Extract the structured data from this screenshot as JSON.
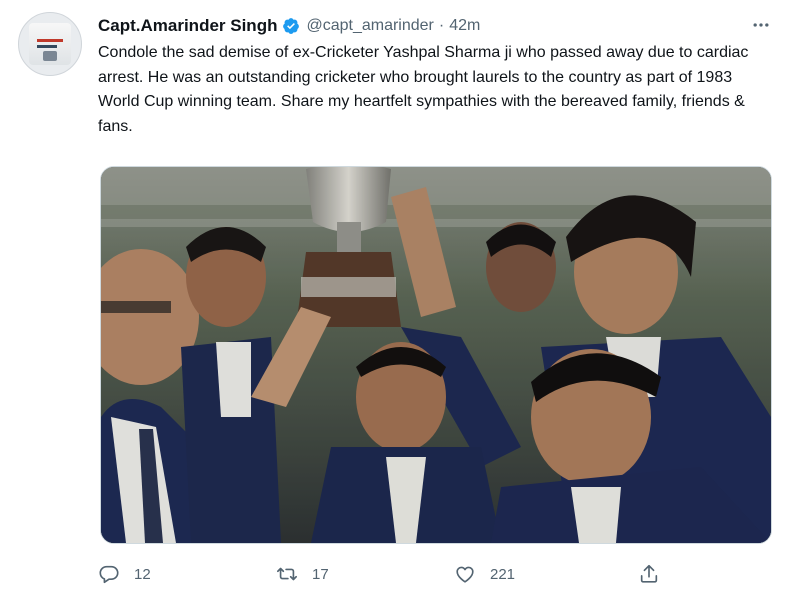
{
  "tweet": {
    "author_name": "Capt.Amarinder Singh",
    "handle": "@capt_amarinder",
    "separator": "·",
    "time": "42m",
    "verified": true,
    "text": "Condole the sad demise of ex-Cricketer Yashpal Sharma ji who passed away due to cardiac arrest. He was an outstanding cricketer who brought laurels to the country as part of 1983 World Cup winning team. Share my heartfelt sympathies with the bereaved family, friends & fans.",
    "media": {
      "type": "photo",
      "alt": "1983 World Cup winning team members holding the trophy"
    },
    "actions": {
      "reply_count": "12",
      "retweet_count": "17",
      "like_count": "221"
    }
  },
  "colors": {
    "verified_blue": "#1d9bf0",
    "secondary_text": "#536471",
    "primary_text": "#0f1419"
  },
  "icons": [
    "more-icon",
    "verified-badge-icon",
    "reply-icon",
    "retweet-icon",
    "like-icon",
    "share-icon"
  ]
}
